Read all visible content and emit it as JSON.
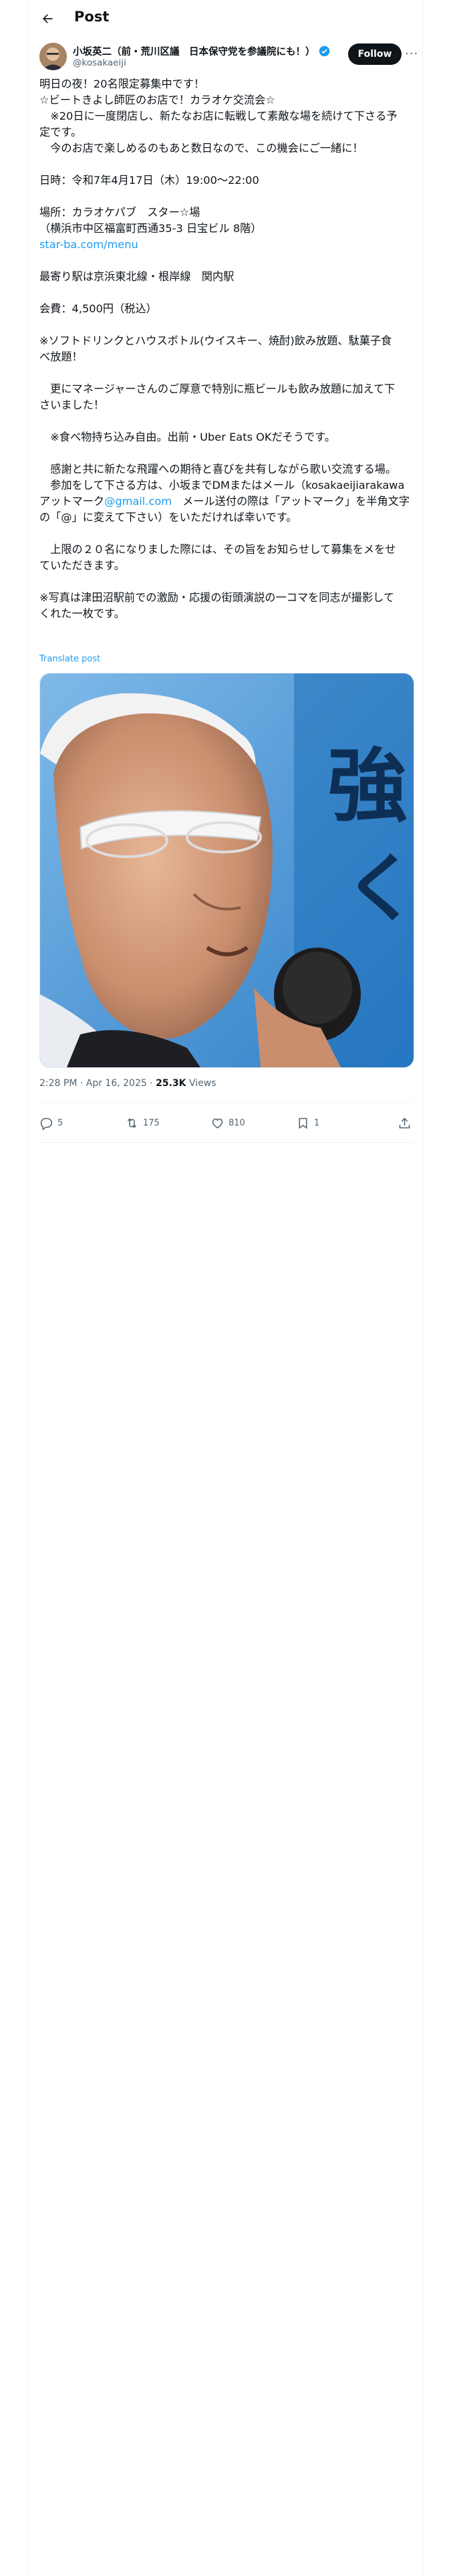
{
  "header": {
    "title": "Post"
  },
  "author": {
    "name": "小坂英二（前・荒川区議　日本保守党を参議院にも！）",
    "handle": "@kosakaeiji"
  },
  "follow_label": "Follow",
  "more_label": "···",
  "post": {
    "lines": [
      {
        "text": "明日の夜！20名限定募集中です！"
      },
      {
        "text": "☆ビートきよし師匠のお店で！カラオケ交流会☆"
      },
      {
        "text": "　※20日に一度閉店し、新たなお店に転戦して素敵な場を続けて下さる予"
      },
      {
        "text": "定です。"
      },
      {
        "text": "　今のお店で楽しめるのもあと数日なので、この機会にご一緒に！"
      },
      {
        "text": ""
      },
      {
        "text": "日時：令和7年4月17日（木）19:00〜22:00"
      },
      {
        "text": ""
      },
      {
        "text": "場所：カラオケパブ　スター☆場"
      },
      {
        "text": "（横浜市中区福富町西通35-3 日宝ビル 8階）"
      },
      {
        "text": "star-ba.com/menu",
        "link": true
      },
      {
        "text": ""
      },
      {
        "text": "最寄り駅は京浜東北線・根岸線　関内駅"
      },
      {
        "text": ""
      },
      {
        "text": "会費：4,500円（税込）"
      },
      {
        "text": ""
      },
      {
        "text": "※ソフトドリンクとハウスボトル(ウイスキー、焼酎)飲み放題、駄菓子食"
      },
      {
        "text": "べ放題！"
      },
      {
        "text": ""
      },
      {
        "text": "　更にマネージャーさんのご厚意で特別に瓶ビールも飲み放題に加えて下"
      },
      {
        "text": "さいました！"
      },
      {
        "text": ""
      },
      {
        "text": "　※食べ物持ち込み自由。出前・Uber Eats OKだそうです。"
      },
      {
        "text": ""
      },
      {
        "text": "　感謝と共に新たな飛躍への期待と喜びを共有しながら歌い交流する場。"
      },
      {
        "text": "　参加をして下さる方は、小坂までDMまたはメール（kosakaeijiarakawa"
      },
      {
        "pre": "アットマーク",
        "link_text": "@gmail.com",
        "post": "　メール送付の際は「アットマーク」を半角文字"
      },
      {
        "text": "の「@」に変えて下さい）をいただければ幸いです。"
      },
      {
        "text": ""
      },
      {
        "text": "　上限の２０名になりました際には、その旨をお知らせして募集をメをせ"
      },
      {
        "text": "ていただきます。"
      },
      {
        "text": ""
      },
      {
        "text": "※写真は津田沼駅前での激励・応援の街頭演説の一コマを同志が撮影して"
      },
      {
        "text": "くれた一枚です。"
      }
    ]
  },
  "translate_label": "Translate post",
  "meta": {
    "time": "2:28 PM · Apr 16, 2025 · ",
    "views": "25.3K",
    "views_label": " Views"
  },
  "actions": {
    "replies": "5",
    "reposts": "175",
    "likes": "810",
    "bookmarks": "1"
  },
  "photo": {
    "sign_text_1": "強",
    "sign_text_2": "く"
  },
  "colors": {
    "accent": "#1d9bf0",
    "text": "#0f1419",
    "secondary": "#536471"
  }
}
